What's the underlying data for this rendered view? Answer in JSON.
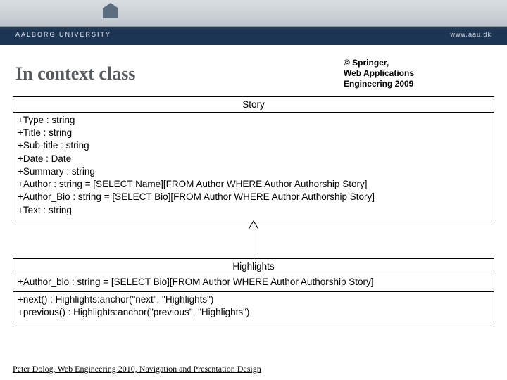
{
  "banner": {
    "university": "AALBORG UNIVERSITY",
    "url": "www.aau.dk"
  },
  "title": "In context class",
  "copyright": {
    "line1": "© Springer,",
    "line2": "Web Applications",
    "line3": "Engineering 2009"
  },
  "story": {
    "name": "Story",
    "attrs": [
      "+Type : string",
      "+Title : string",
      "+Sub-title : string",
      "+Date : Date",
      "+Summary : string",
      "+Author : string = [SELECT Name][FROM Author WHERE Author Authorship Story]",
      "+Author_Bio : string = [SELECT Bio][FROM Author WHERE Author Authorship Story]",
      "+Text : string"
    ]
  },
  "highlights": {
    "name": "Highlights",
    "attrs": [
      "+Author_bio : string = [SELECT Bio][FROM Author WHERE Author Authorship Story]"
    ],
    "ops": [
      "+next() : Highlights:anchor(\"next\", \"Highlights\")",
      "+previous() : Highlights:anchor(\"previous\", \"Highlights\")"
    ]
  },
  "footer": "Peter Dolog, Web Engineering 2010, Navigation and Presentation Design"
}
